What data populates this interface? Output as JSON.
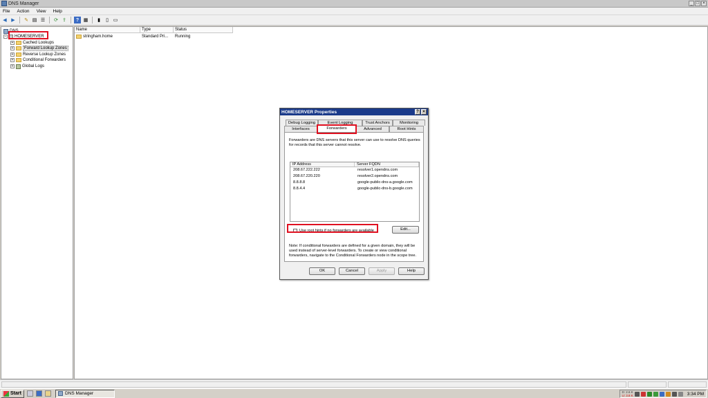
{
  "window": {
    "title": "DNS Manager"
  },
  "menu": [
    "File",
    "Action",
    "View",
    "Help"
  ],
  "tree": {
    "root": "DNS",
    "server": "HOMESERVER",
    "children": [
      "Cached Lookups",
      "Forward Lookup Zones",
      "Reverse Lookup Zones",
      "Conditional Forwarders",
      "Global Logs"
    ]
  },
  "list": {
    "columns": [
      "Name",
      "Type",
      "Status"
    ],
    "rows": [
      {
        "name": "stringham.home",
        "type": "Standard Pri...",
        "status": "Running"
      }
    ]
  },
  "dialog": {
    "title": "HOMESERVER Properties",
    "tabs_row1": [
      "Debug Logging",
      "Event Logging",
      "Trust Anchors",
      "Monitoring"
    ],
    "tabs_row2": [
      "Interfaces",
      "Forwarders",
      "Advanced",
      "Root Hints"
    ],
    "active_tab": "Forwarders",
    "description": "Forwarders are DNS servers that this server can use to resolve DNS queries for records that this server cannot resolve.",
    "columns": [
      "IP Address",
      "Server FQDN"
    ],
    "forwarders": [
      {
        "ip": "208.67.222.222",
        "fqdn": "resolver1.opendns.com"
      },
      {
        "ip": "208.67.220.220",
        "fqdn": "resolver2.opendns.com"
      },
      {
        "ip": "8.8.8.8",
        "fqdn": "google-public-dns-a.google.com"
      },
      {
        "ip": "8.8.4.4",
        "fqdn": "google-public-dns-b.google.com"
      }
    ],
    "root_hints_label": "Use root hints if no forwarders are available",
    "root_hints_checked": false,
    "edit_label": "Edit...",
    "note": "Note: If conditional forwarders are defined for a given domain, they will be used instead of server-level forwarders. To create or view conditional forwarders, navigate to the Conditional Forwarders node in the scope tree.",
    "buttons": {
      "ok": "OK",
      "cancel": "Cancel",
      "apply": "Apply",
      "help": "Help"
    }
  },
  "taskbar": {
    "start": "Start",
    "task": "DNS Manager",
    "net_down": "D: 2.6 K",
    "net_up": "U: 3.8 K",
    "clock": "3:34 PM"
  },
  "colors": {
    "highlight": "#e01020",
    "dialog_title": "#1a3a8a"
  }
}
